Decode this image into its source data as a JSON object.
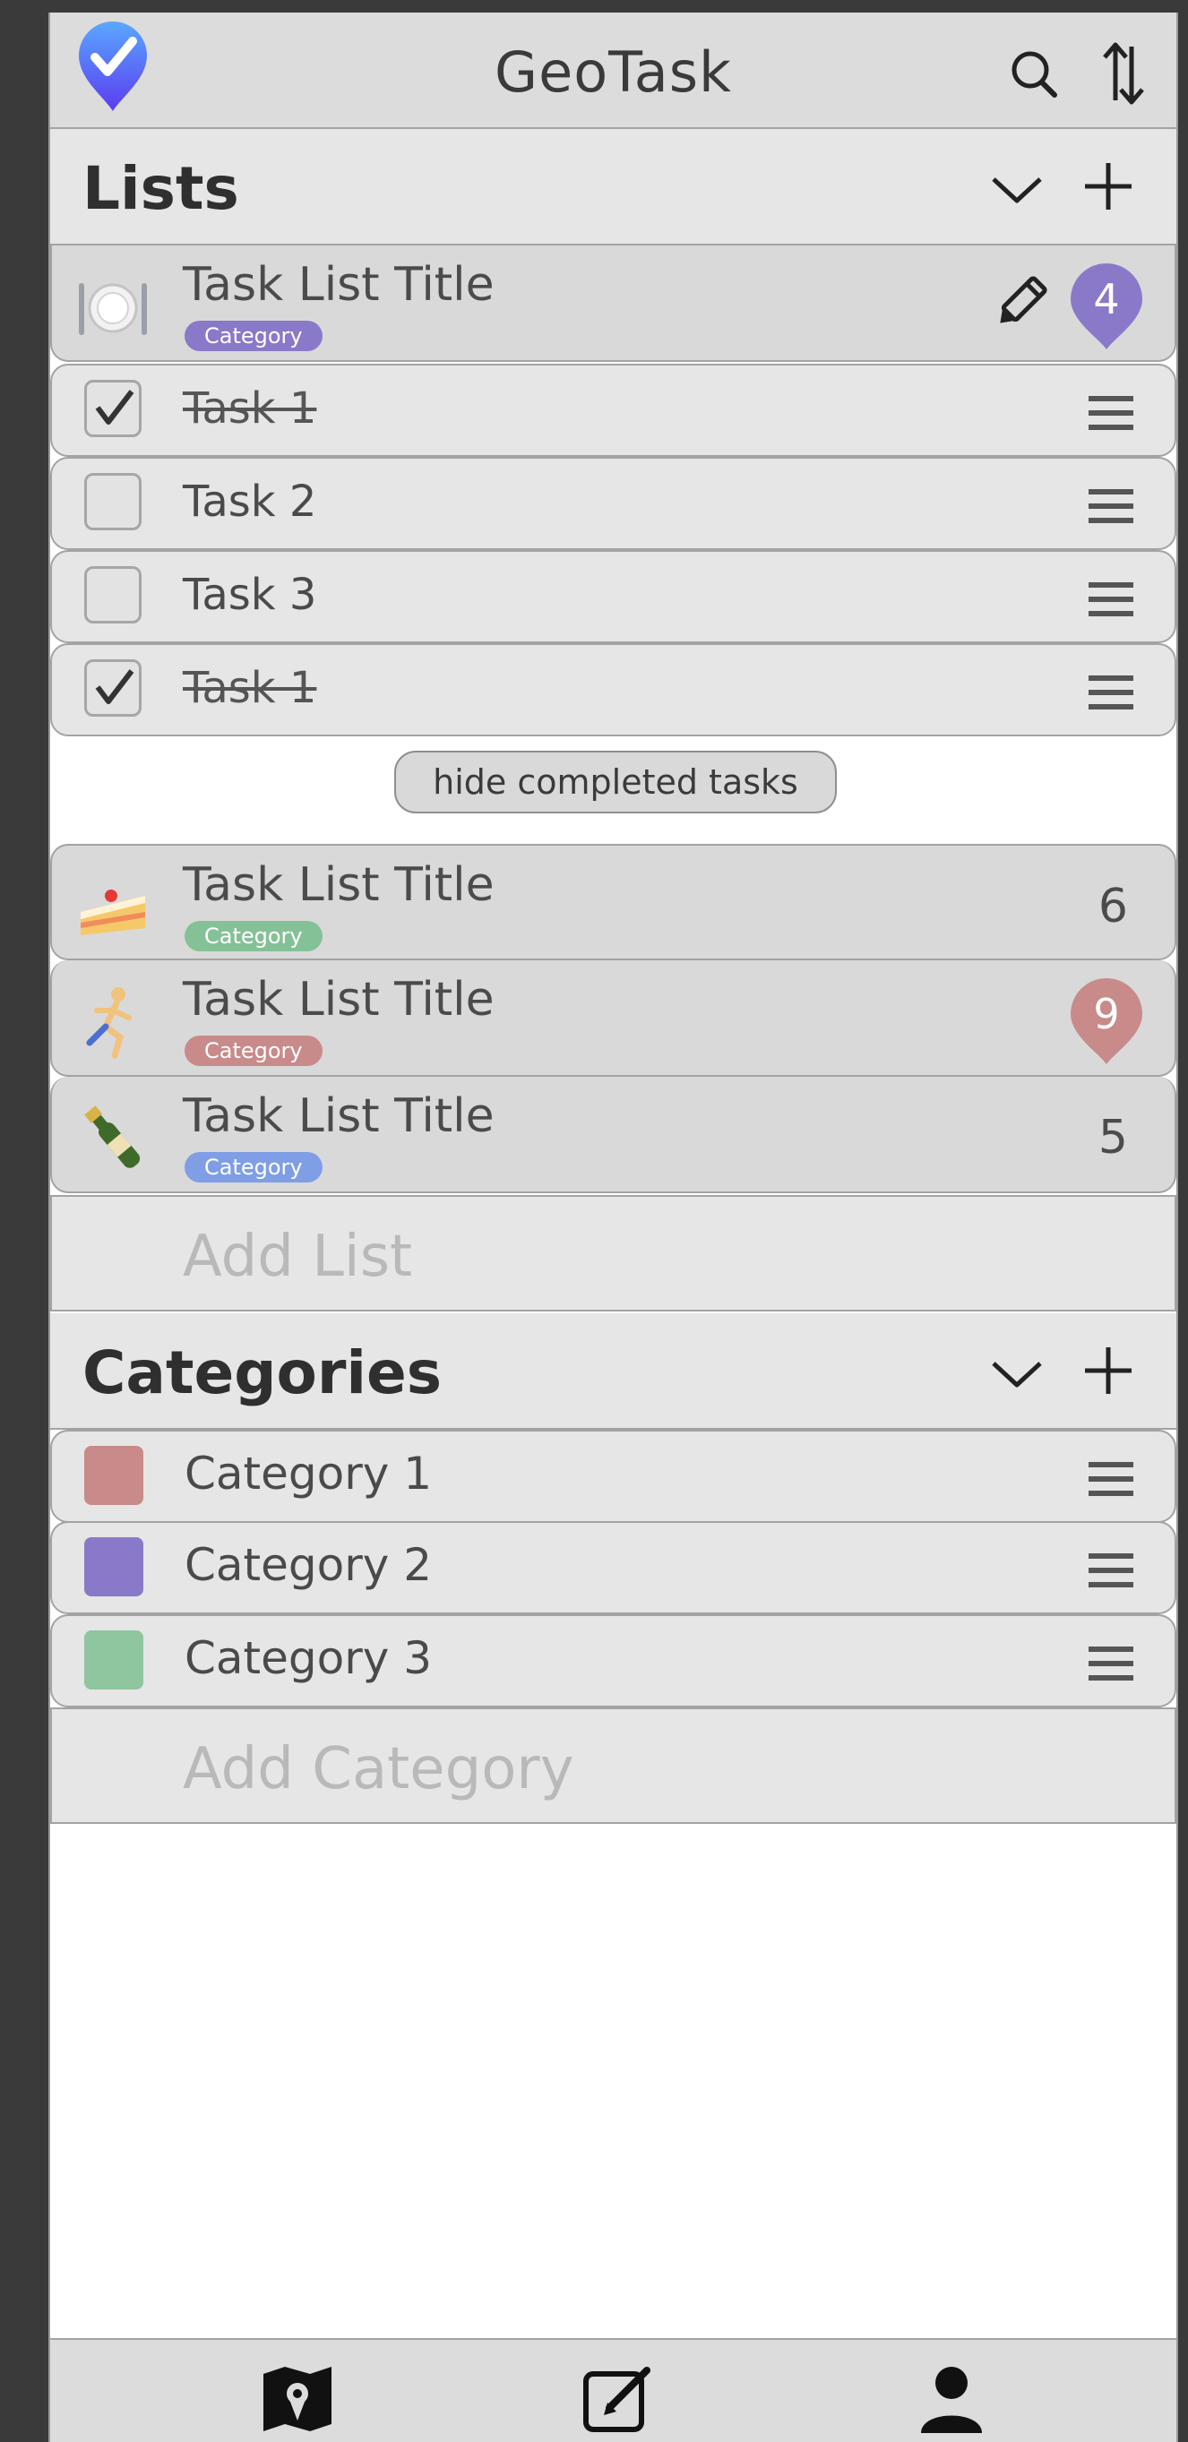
{
  "header": {
    "title": "GeoTask",
    "logo_icon": "check-pin-logo-icon",
    "search_icon": "search-icon",
    "sort_icon": "sort-arrows-icon"
  },
  "lists_section": {
    "title": "Lists",
    "task_lists": [
      {
        "title": "Task List Title",
        "category": "Category",
        "category_color": "#8a79c9",
        "emoji": "plate-cutlery-icon",
        "count": "4",
        "count_style": "pin",
        "pin_color": "#8a79c9",
        "expanded": true,
        "tasks": [
          {
            "label": "Task 1",
            "done": true
          },
          {
            "label": "Task 2",
            "done": false
          },
          {
            "label": "Task 3",
            "done": false
          },
          {
            "label": "Task 1",
            "done": true
          }
        ]
      },
      {
        "title": "Task List Title",
        "category": "Category",
        "category_color": "#85c197",
        "emoji": "cake-icon",
        "count": "6",
        "count_style": "plain"
      },
      {
        "title": "Task List Title",
        "category": "Category",
        "category_color": "#c98a8a",
        "emoji": "runner-icon",
        "count": "9",
        "count_style": "pin",
        "pin_color": "#c98a8a"
      },
      {
        "title": "Task List Title",
        "category": "Category",
        "category_color": "#7f9ee6",
        "emoji": "champagne-icon",
        "count": "5",
        "count_style": "plain"
      }
    ],
    "hide_completed_label": "hide completed tasks",
    "add_list_placeholder": "Add List"
  },
  "categories_section": {
    "title": "Categories",
    "items": [
      {
        "label": "Category 1",
        "color": "#c98a8a"
      },
      {
        "label": "Category 2",
        "color": "#8a79c9"
      },
      {
        "label": "Category 3",
        "color": "#8fc59f"
      }
    ],
    "add_category_placeholder": "Add Category"
  },
  "bottom_nav": {
    "items": [
      "map-icon",
      "edit-icon",
      "profile-icon"
    ]
  }
}
